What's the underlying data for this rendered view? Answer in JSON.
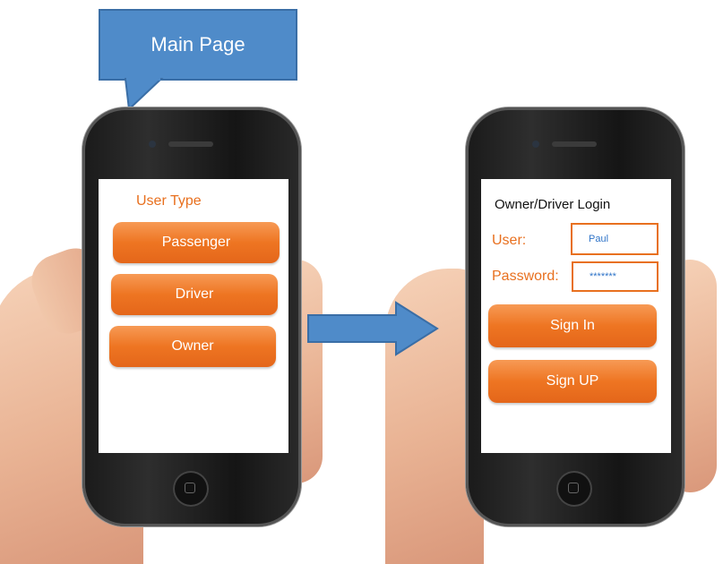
{
  "callout": {
    "text": "Main Page"
  },
  "screen1": {
    "heading": "User Type",
    "buttons": [
      "Passenger",
      "Driver",
      "Owner"
    ]
  },
  "screen2": {
    "heading": "Owner/Driver Login",
    "user_label": "User:",
    "user_value": "Paul",
    "password_label": "Password:",
    "password_value": "*******",
    "signin": "Sign In",
    "signup": "Sign UP"
  },
  "colors": {
    "accent": "#ee7522",
    "callout": "#4f8bc9",
    "arrow": "#4f8bc9"
  }
}
